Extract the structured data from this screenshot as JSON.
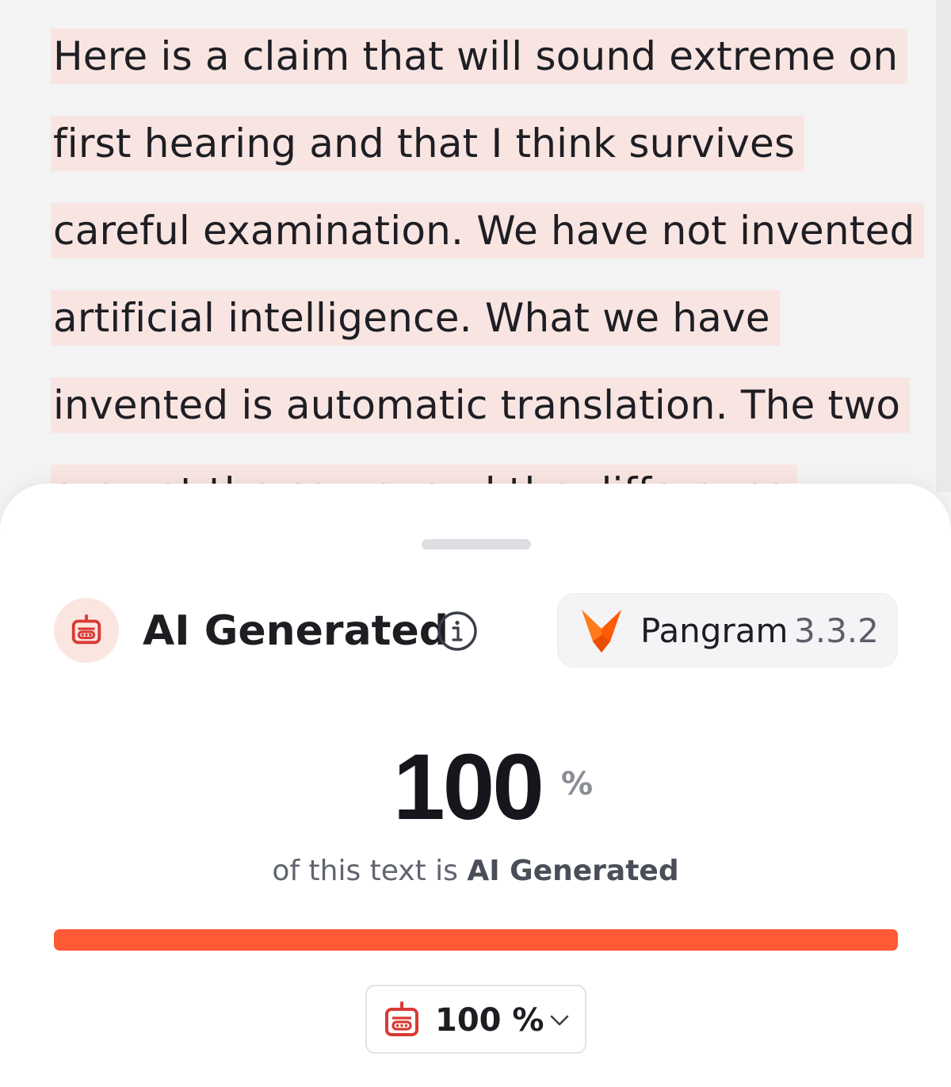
{
  "document": {
    "lines": [
      "Here is a claim that will sound extreme on",
      "first hearing and that I think survives",
      "careful examination. We have not invented",
      "artificial intelligence. What we have",
      "invented is automatic translation. The two",
      "are not the same, and the difference"
    ]
  },
  "result": {
    "label": "AI Generated",
    "status_icon": "robot-icon",
    "info_icon": "info-icon",
    "model": {
      "logo_icon": "fox-logo-icon",
      "name": "Pangram",
      "version": "3.3.2"
    },
    "score": "100",
    "score_unit": "%",
    "caption_prefix": "of this text is",
    "caption_emphasis": "AI Generated",
    "progress_fraction": 1.0,
    "dropdown": {
      "value": "100 %",
      "icon": "robot-icon",
      "chevron_icon": "chevron-down-icon"
    }
  },
  "colors": {
    "highlight": "#f8e5e1",
    "accent": "#ff5a36",
    "robot_red": "#d93a34"
  }
}
